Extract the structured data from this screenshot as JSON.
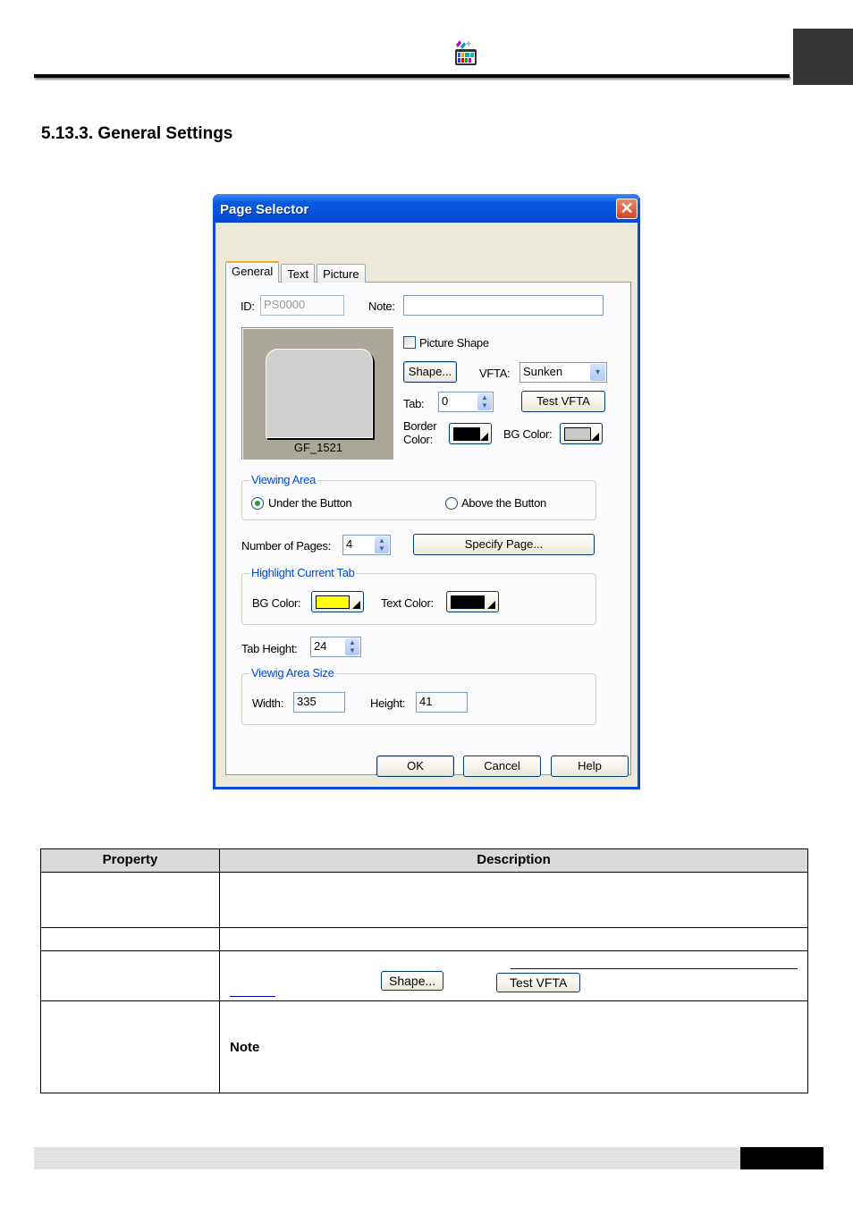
{
  "header": {
    "logo_icon": "palette-calendar-icon"
  },
  "section": {
    "title": "5.13.3. General Settings"
  },
  "dialog": {
    "title": "Page Selector",
    "close_icon": "close-icon",
    "tabs": [
      {
        "label": "General",
        "active": true
      },
      {
        "label": "Text",
        "active": false
      },
      {
        "label": "Picture",
        "active": false
      }
    ],
    "id_label": "ID:",
    "id_value": "PS0000",
    "note_label": "Note:",
    "note_value": "",
    "preview_label": "GF_1521",
    "picture_shape_label": "Picture Shape",
    "picture_shape_checked": false,
    "shape_button": "Shape...",
    "vfta_label": "VFTA:",
    "vfta_value": "Sunken",
    "tab_label": "Tab:",
    "tab_value": "0",
    "test_vfta_button": "Test VFTA",
    "border_color_label_1": "Border",
    "border_color_label_2": "Color:",
    "border_color": "#000000",
    "bg_color_label": "BG Color:",
    "bg_color": "#c8c8c8",
    "viewing_area": {
      "title": "Viewing Area",
      "options": [
        {
          "label": "Under the Button",
          "selected": true
        },
        {
          "label": "Above the Button",
          "selected": false
        }
      ]
    },
    "pages_label": "Number of Pages:",
    "pages_value": "4",
    "specify_page_button": "Specify Page...",
    "highlight": {
      "title": "Highlight Current Tab",
      "bg_label": "BG Color:",
      "bg_color": "#ffff00",
      "text_label": "Text Color:",
      "text_color": "#000000"
    },
    "tab_height_label": "Tab Height:",
    "tab_height_value": "24",
    "viewing_size": {
      "title": "Viewig Area Size",
      "width_label": "Width:",
      "width_value": "335",
      "height_label": "Height:",
      "height_value": "41"
    },
    "buttons": {
      "ok": "OK",
      "cancel": "Cancel",
      "help": "Help"
    }
  },
  "table": {
    "headers": [
      "Property",
      "Description"
    ],
    "row3_buttons": {
      "shape": "Shape...",
      "test_vfta": "Test VFTA"
    },
    "row4_note": "Note"
  }
}
